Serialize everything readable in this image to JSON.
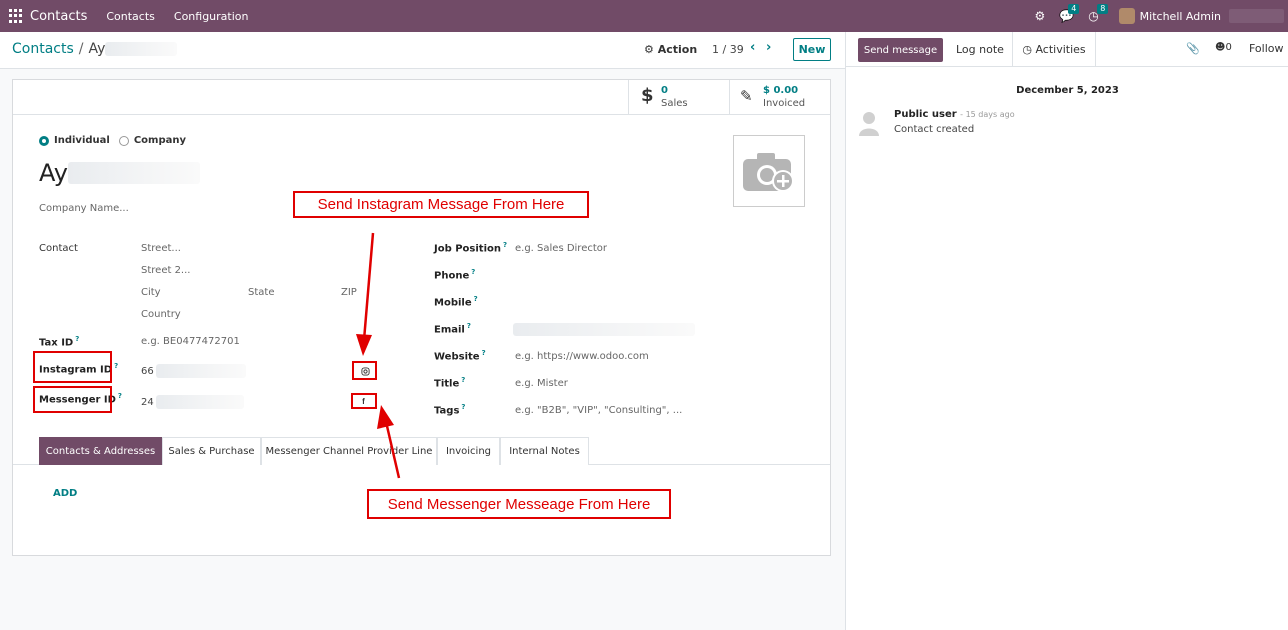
{
  "navbar": {
    "brand": "Contacts",
    "menu": [
      "Contacts",
      "Configuration"
    ],
    "messages_badge": "4",
    "activities_badge": "8",
    "user": "Mitchell Admin"
  },
  "control_panel": {
    "breadcrumb_root": "Contacts",
    "breadcrumb_sep": "/",
    "breadcrumb_current": "Ay",
    "action_label": "Action",
    "pager": "1 / 39",
    "new_label": "New"
  },
  "stat_buttons": {
    "sales_value": "0",
    "sales_label": "Sales",
    "invoiced_value": "$ 0.00",
    "invoiced_label": "Invoiced"
  },
  "form": {
    "type_individual": "Individual",
    "type_company": "Company",
    "name": "Ay",
    "company_name_placeholder": "Company Name...",
    "contact_label": "Contact",
    "street": "Street...",
    "street2": "Street 2...",
    "city": "City",
    "state": "State",
    "zip": "ZIP",
    "country": "Country",
    "tax_id_label": "Tax ID",
    "tax_id_placeholder": "e.g. BE0477472701",
    "instagram_label": "Instagram ID",
    "instagram_value": "66",
    "messenger_label": "Messenger ID",
    "messenger_value": "24",
    "help_mark": "?",
    "job_position_label": "Job Position",
    "job_position_placeholder": "e.g. Sales Director",
    "phone_label": "Phone",
    "mobile_label": "Mobile",
    "email_label": "Email",
    "website_label": "Website",
    "website_placeholder": "e.g. https://www.odoo.com",
    "title_label": "Title",
    "title_placeholder": "e.g. Mister",
    "tags_label": "Tags",
    "tags_placeholder": "e.g. \"B2B\", \"VIP\", \"Consulting\", ..."
  },
  "tabs": [
    "Contacts & Addresses",
    "Sales & Purchase",
    "Messenger Channel Provider Line",
    "Invoicing",
    "Internal Notes"
  ],
  "add_label": "ADD",
  "annotations": {
    "instagram": "Send Instagram Message From Here",
    "messenger": "Send Messenger Messeage From Here"
  },
  "chatter": {
    "send_message": "Send message",
    "log_note": "Log note",
    "activities": "Activities",
    "followers_count": "0",
    "follow": "Follow",
    "date": "December 5, 2023",
    "author": "Public user",
    "time": "- 15 days ago",
    "body": "Contact created"
  },
  "colors": {
    "brand": "#714b67",
    "accent": "#017e84",
    "annotation": "#e00000"
  }
}
